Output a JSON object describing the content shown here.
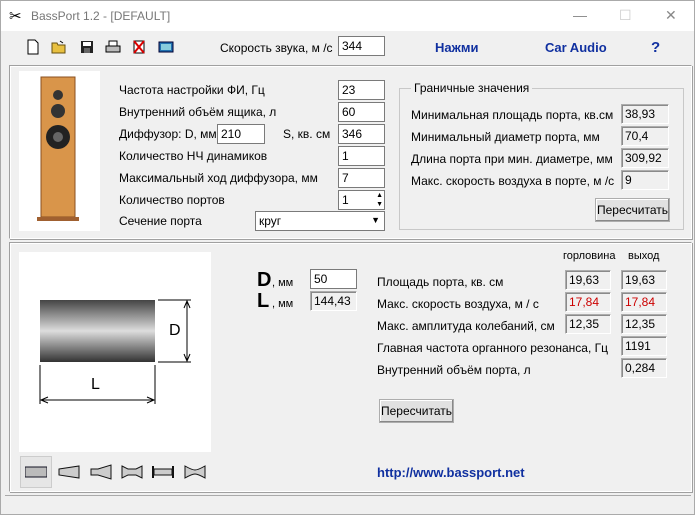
{
  "window": {
    "title": "BassPort 1.2 - [DEFAULT]"
  },
  "toolbar": {
    "icons": [
      "new-file-icon",
      "open-folder-icon",
      "save-icon",
      "print-icon",
      "delete-icon",
      "calculator-icon"
    ],
    "sound_speed_label": "Скорость звука, м /с",
    "sound_speed_value": "344",
    "press_label": "Нажми",
    "car_audio_label": "Car Audio",
    "help_label": "?"
  },
  "params": {
    "tuning_freq_label": "Частота настройки ФИ, Гц",
    "tuning_freq": "23",
    "box_volume_label": "Внутренний объём ящика, л",
    "box_volume": "60",
    "diffuser_label": "Диффузор: D, мм",
    "diffuser_d": "210",
    "area_label": "S, кв. см",
    "area": "346",
    "woofers_label": "Количество НЧ динамиков",
    "woofers": "1",
    "xmax_label": "Максимальный ход диффузора, мм",
    "xmax": "7",
    "ports_label": "Количество портов",
    "ports": "1",
    "section_label": "Сечение порта",
    "section": "круг"
  },
  "limits": {
    "title": "Граничные значения",
    "min_area_label": "Минимальная площадь порта, кв.см",
    "min_area": "38,93",
    "min_diam_label": "Минимальный диаметр порта, мм",
    "min_diam": "70,4",
    "length_label": "Длина порта при мин. диаметре, мм",
    "length": "309,92",
    "max_air_label": "Макс. скорость воздуха в порте, м /с",
    "max_air": "9",
    "recalc_label": "Пересчитать"
  },
  "port": {
    "d_letter": "D",
    "d_unit": ", мм",
    "d_value": "50",
    "l_letter": "L",
    "l_unit": ", мм",
    "l_value": "144,43",
    "diagram_d": "D",
    "diagram_l": "L",
    "col_throat": "горловина",
    "col_exit": "выход",
    "rows": [
      {
        "label": "Площадь порта, кв. см",
        "throat": "19,63",
        "exit": "19,63",
        "warn": false
      },
      {
        "label": "Макс. скорость воздуха, м / с",
        "throat": "17,84",
        "exit": "17,84",
        "warn": true
      },
      {
        "label": "Макс. амплитуда колебаний, см",
        "throat": "12,35",
        "exit": "12,35",
        "warn": false
      },
      {
        "label": "Главная частота органного резонанса, Гц",
        "exit": "1191",
        "warn": false
      },
      {
        "label": "Внутренний объём порта, л",
        "exit": "0,284",
        "warn": false
      }
    ],
    "recalc_label": "Пересчитать",
    "url": "http://www.bassport.net",
    "shapes": [
      "straight-port-icon",
      "cone-port-icon",
      "flared-cone-port-icon",
      "double-cone-port-icon",
      "flanged-port-icon",
      "double-flared-port-icon"
    ]
  },
  "colors": {
    "warn": "#cc0000",
    "link": "#1030a0"
  }
}
